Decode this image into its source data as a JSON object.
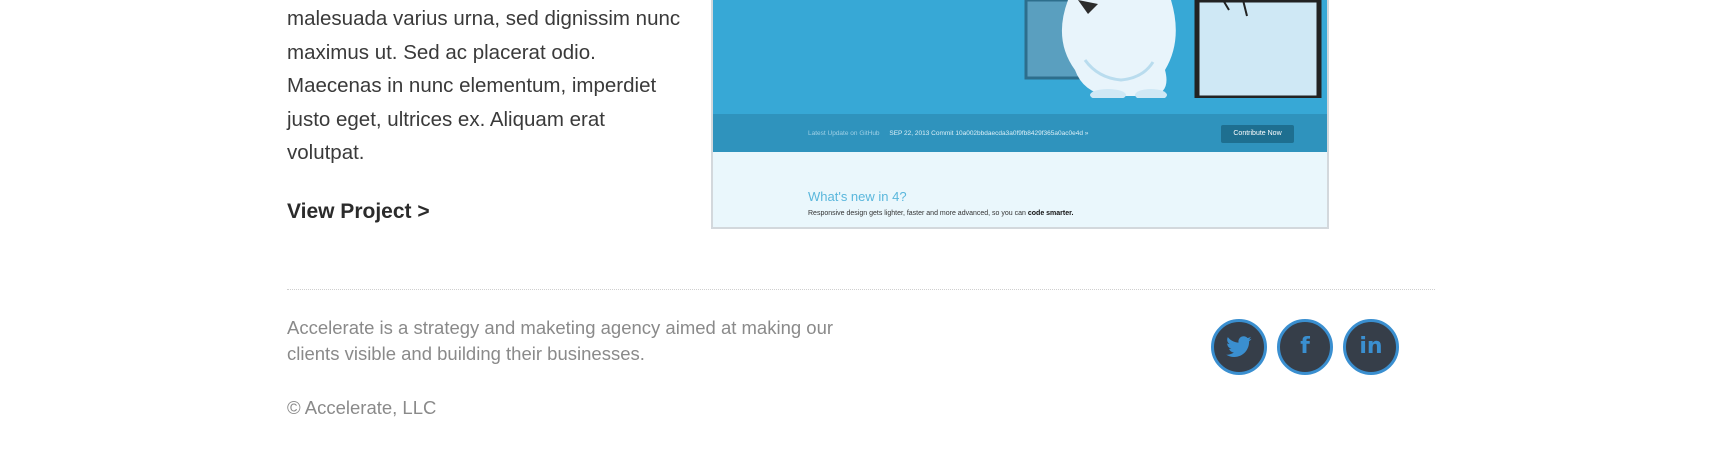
{
  "project": {
    "description": "malesuada varius urna, sed dignissim nunc maximus ut. Sed ac placerat odio. Maecenas in nunc elementum, imperdiet justo eget, ultrices ex. Aliquam erat volutpat.",
    "view_link": "View Project >"
  },
  "screenshot": {
    "strip_label": "Latest Update on GitHub",
    "strip_commit": "SEP 22, 2013 Commit 10a002bbdaecda3a0f9fb8429f365a0ac0e4d »",
    "button_label": "Contribute Now",
    "heading": "What's new in 4?",
    "subtext_prefix": "Responsive design gets lighter, faster and more advanced, so you can",
    "subtext_bold": "code smarter."
  },
  "footer": {
    "tagline": "Accelerate is a strategy and maketing agency aimed at making our clients visible and building their businesses.",
    "copyright": "© Accelerate, LLC",
    "social": [
      {
        "name": "twitter-icon",
        "glyph": ""
      },
      {
        "name": "facebook-icon",
        "glyph": "f"
      },
      {
        "name": "linkedin-icon",
        "glyph": "in"
      }
    ]
  },
  "colors": {
    "social_ring": "#3a8fd0",
    "social_fill": "#363e49",
    "hero_blue": "#37a8d6"
  }
}
